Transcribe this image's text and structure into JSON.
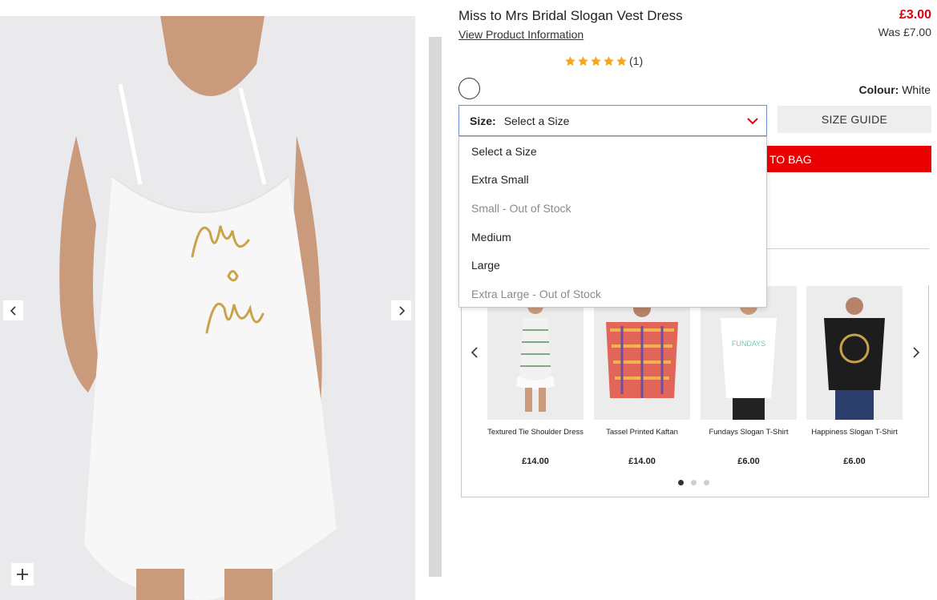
{
  "product": {
    "title": "Miss to Mrs Bridal Slogan Vest Dress",
    "view_info": "View Product Information",
    "price": "£3.00",
    "was": "Was £7.00",
    "rating_count": "(1)",
    "rating_stars": 5,
    "print_text": "Miss to Mrs",
    "colour_label": "Colour:",
    "colour_value": "White"
  },
  "size": {
    "label": "Size:",
    "selected": "Select a Size",
    "options": [
      {
        "label": "Select a Size",
        "in_stock": true
      },
      {
        "label": "Extra Small",
        "in_stock": true
      },
      {
        "label": "Small - Out of Stock",
        "in_stock": false
      },
      {
        "label": "Medium",
        "in_stock": true
      },
      {
        "label": "Large",
        "in_stock": true
      },
      {
        "label": "Extra Large - Out of Stock",
        "in_stock": false
      }
    ]
  },
  "buttons": {
    "size_guide": "SIZE GUIDE",
    "add_to_bag": "ADD TO BAG",
    "add_to_bag_visible": "TO BAG"
  },
  "recommendations": [
    {
      "name": "Textured Tie Shoulder Dress",
      "price": "£14.00"
    },
    {
      "name": "Tassel Printed Kaftan",
      "price": "£14.00"
    },
    {
      "name": "Fundays Slogan T-Shirt",
      "price": "£6.00"
    },
    {
      "name": "Happiness Slogan T-Shirt",
      "price": "£6.00"
    }
  ],
  "carousel": {
    "pages": 3,
    "active_page": 1
  },
  "colors": {
    "accent_red": "#e1000f",
    "button_red": "#ea0000",
    "star": "#f5a623"
  },
  "icons": [
    "chevron-left-icon",
    "chevron-right-icon",
    "zoom-plus-icon",
    "star-icon",
    "chevron-down-icon"
  ]
}
